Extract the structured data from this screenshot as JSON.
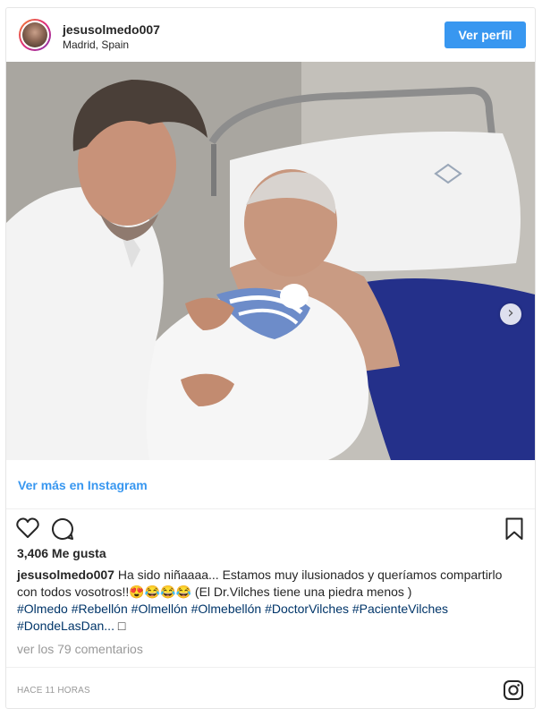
{
  "header": {
    "username": "jesusolmedo007",
    "location": "Madrid, Spain",
    "view_profile_label": "Ver perfil"
  },
  "photo": {
    "next_label": "›"
  },
  "embed": {
    "view_more_label": "Ver más en Instagram"
  },
  "actions": {
    "like_icon": "heart-outline",
    "comment_icon": "speech-bubble-outline",
    "save_icon": "bookmark-outline"
  },
  "likes": {
    "text": "3,406 Me gusta"
  },
  "caption": {
    "username": "jesusolmedo007",
    "text": "Ha sido niñaaaa... Estamos muy ilusionados y queríamos compartirlo con todos vosotros!!😍😂😂😂 (El Dr.Vilches tiene una piedra menos )",
    "hashtags": [
      "#Olmedo",
      "#Rebellón",
      "#Olmellón",
      "#Olmebellón",
      "#DoctorVilches",
      "#PacienteVilches",
      "#DondeLasDan..."
    ],
    "trailing": "□"
  },
  "comments": {
    "text": "ver los 79 comentarios"
  },
  "footer": {
    "time": "HACE 11 HORAS",
    "logo_icon": "instagram-logo"
  }
}
